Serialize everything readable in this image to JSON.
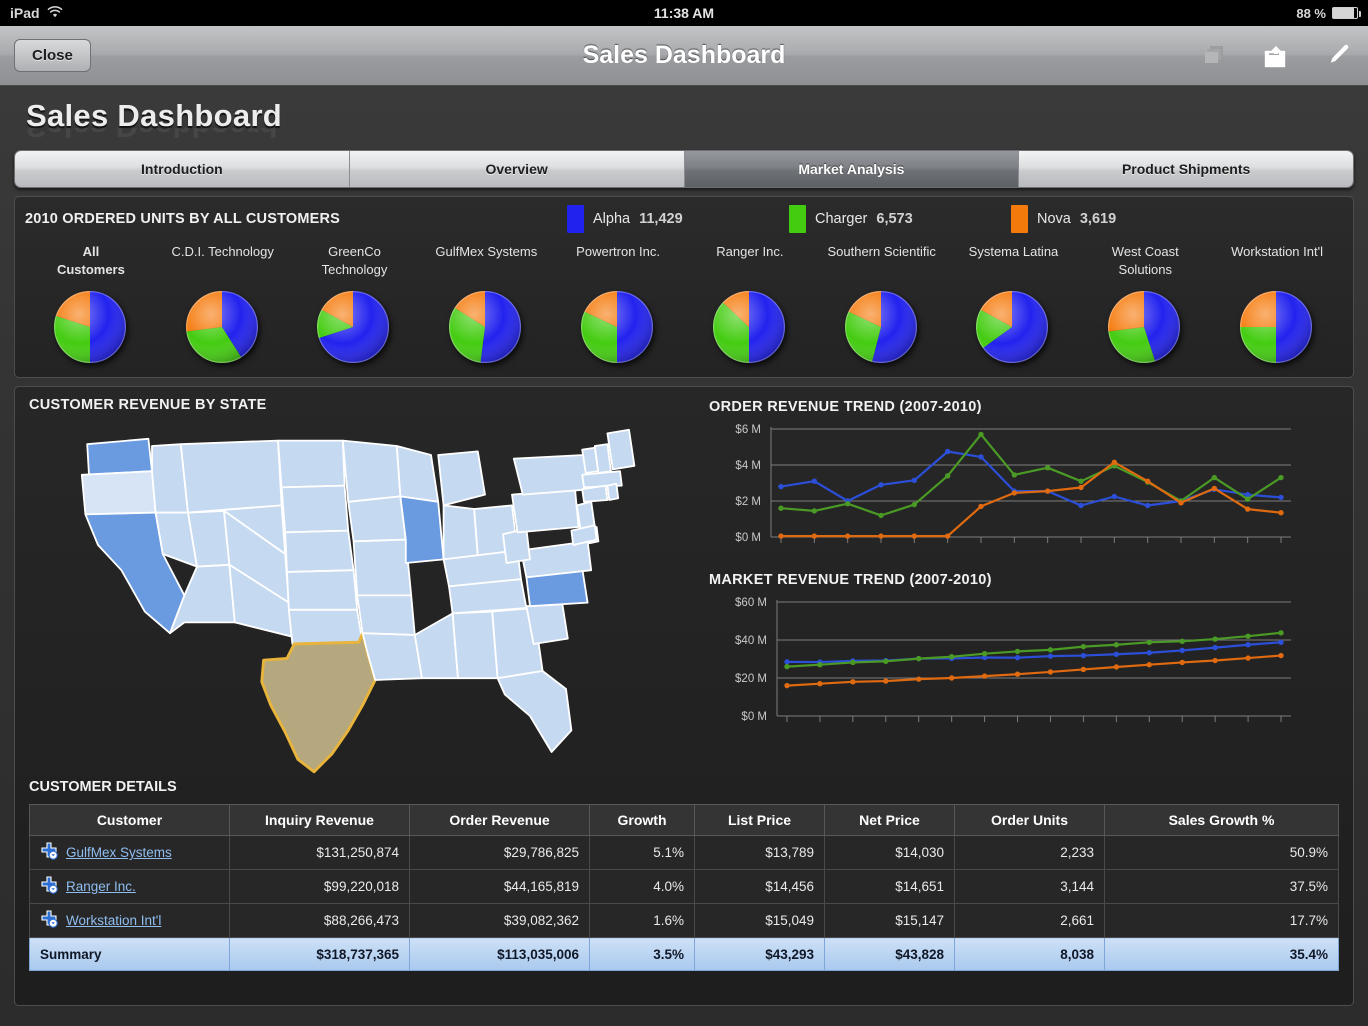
{
  "status_bar": {
    "device": "iPad",
    "wifi_icon": "wifi-icon",
    "time": "11:38 AM",
    "battery_percent": "88 %",
    "battery_level": 88
  },
  "toolbar": {
    "close_label": "Close",
    "title": "Sales Dashboard",
    "icons": [
      "layers-icon",
      "share-icon",
      "pencil-icon"
    ]
  },
  "header": {
    "dashboard_title": "Sales Dashboard"
  },
  "tabs": [
    {
      "label": "Introduction",
      "active": false
    },
    {
      "label": "Overview",
      "active": false
    },
    {
      "label": "Market Analysis",
      "active": true
    },
    {
      "label": "Product Shipments",
      "active": false
    }
  ],
  "pie_section": {
    "title": "2010 ORDERED UNITS BY ALL CUSTOMERS",
    "legend": [
      {
        "name": "Alpha",
        "value": "11,429",
        "color": "#2222ee"
      },
      {
        "name": "Charger",
        "value": "6,573",
        "color": "#44cc11"
      },
      {
        "name": "Nova",
        "value": "3,619",
        "color": "#f57a0c"
      }
    ]
  },
  "map_section": {
    "title": "CUSTOMER REVENUE BY STATE"
  },
  "table_section": {
    "title": "CUSTOMER DETAILS",
    "columns": [
      "Customer",
      "Inquiry Revenue",
      "Order Revenue",
      "Growth",
      "List Price",
      "Net Price",
      "Order Units",
      "Sales Growth %"
    ],
    "rows": [
      {
        "customer": "GulfMex Systems",
        "inquiry_revenue": "$131,250,874",
        "order_revenue": "$29,786,825",
        "growth": "5.1%",
        "list_price": "$13,789",
        "net_price": "$14,030",
        "order_units": "2,233",
        "sales_growth": "50.9%"
      },
      {
        "customer": "Ranger Inc.",
        "inquiry_revenue": "$99,220,018",
        "order_revenue": "$44,165,819",
        "growth": "4.0%",
        "list_price": "$14,456",
        "net_price": "$14,651",
        "order_units": "3,144",
        "sales_growth": "37.5%"
      },
      {
        "customer": "Workstation Int'l",
        "inquiry_revenue": "$88,266,473",
        "order_revenue": "$39,082,362",
        "growth": "1.6%",
        "list_price": "$15,049",
        "net_price": "$15,147",
        "order_units": "2,661",
        "sales_growth": "17.7%"
      }
    ],
    "summary": {
      "customer": "Summary",
      "inquiry_revenue": "$318,737,365",
      "order_revenue": "$113,035,006",
      "growth": "3.5%",
      "list_price": "$43,293",
      "net_price": "$43,828",
      "order_units": "8,038",
      "sales_growth": "35.4%"
    }
  },
  "chart_data": [
    {
      "type": "pie",
      "title": "2010 ORDERED UNITS BY ALL CUSTOMERS",
      "series_names": [
        "Alpha",
        "Charger",
        "Nova"
      ],
      "colors": [
        "#2222ee",
        "#44cc11",
        "#f57a0c"
      ],
      "totals": {
        "Alpha": 11429,
        "Charger": 6573,
        "Nova": 3619
      },
      "pies": [
        {
          "label": "All Customers",
          "label_lines": [
            "All",
            "Customers"
          ],
          "bold": true,
          "values": [
            50,
            30,
            20
          ]
        },
        {
          "label": "C.D.I. Technology",
          "label_lines": [
            "C.D.I. Technology"
          ],
          "bold": false,
          "values": [
            41,
            32,
            27
          ]
        },
        {
          "label": "GreenCo Technology",
          "label_lines": [
            "GreenCo",
            "Technology"
          ],
          "bold": false,
          "values": [
            70,
            13,
            17
          ]
        },
        {
          "label": "GulfMex Systems",
          "label_lines": [
            "GulfMex Systems"
          ],
          "bold": false,
          "values": [
            52,
            32,
            16
          ]
        },
        {
          "label": "Powertron Inc.",
          "label_lines": [
            "Powertron Inc."
          ],
          "bold": false,
          "values": [
            50,
            32,
            18
          ]
        },
        {
          "label": "Ranger Inc.",
          "label_lines": [
            "Ranger Inc."
          ],
          "bold": false,
          "values": [
            50,
            37,
            13
          ]
        },
        {
          "label": "Southern Scientific",
          "label_lines": [
            "Southern Scientific"
          ],
          "bold": false,
          "values": [
            54,
            28,
            18
          ]
        },
        {
          "label": "Systema Latina",
          "label_lines": [
            "Systema Latina"
          ],
          "bold": false,
          "values": [
            65,
            18,
            17
          ]
        },
        {
          "label": "West Coast Solutions",
          "label_lines": [
            "West Coast",
            "Solutions"
          ],
          "bold": false,
          "values": [
            45,
            28,
            27
          ]
        },
        {
          "label": "Workstation Int'l",
          "label_lines": [
            "Workstation Int'l"
          ],
          "bold": false,
          "values": [
            50,
            25,
            25
          ]
        }
      ]
    },
    {
      "type": "line",
      "title": "ORDER REVENUE TREND (2007-2010)",
      "ylabel": "",
      "xlabel": "",
      "ytick_labels": [
        "$0 M",
        "$2 M",
        "$4 M",
        "$6 M"
      ],
      "ylim": [
        0,
        6
      ],
      "grid": true,
      "legend": "none",
      "x": [
        1,
        2,
        3,
        4,
        5,
        6,
        7,
        8,
        9,
        10,
        11,
        12,
        13,
        14,
        15,
        16
      ],
      "series": [
        {
          "name": "Alpha",
          "color": "#2b4fd8",
          "values": [
            2.8,
            3.1,
            2.0,
            2.9,
            3.15,
            4.75,
            4.45,
            2.55,
            2.55,
            1.75,
            2.25,
            1.75,
            2.0,
            2.65,
            2.35,
            2.2
          ]
        },
        {
          "name": "Charger",
          "color": "#4a9a25",
          "values": [
            1.6,
            1.45,
            1.85,
            1.2,
            1.8,
            3.4,
            5.7,
            3.45,
            3.85,
            3.1,
            3.95,
            3.05,
            2.0,
            3.3,
            2.1,
            3.3
          ]
        },
        {
          "name": "Nova",
          "color": "#e06a10",
          "values": [
            0.05,
            0.05,
            0.05,
            0.05,
            0.05,
            0.05,
            1.7,
            2.45,
            2.55,
            2.75,
            4.15,
            3.1,
            1.9,
            2.7,
            1.55,
            1.35
          ]
        }
      ]
    },
    {
      "type": "line",
      "title": "MARKET REVENUE TREND (2007-2010)",
      "ylabel": "",
      "xlabel": "",
      "ytick_labels": [
        "$0 M",
        "$20 M",
        "$40 M",
        "$60 M"
      ],
      "ylim": [
        0,
        60
      ],
      "grid": true,
      "legend": "none",
      "x": [
        1,
        2,
        3,
        4,
        5,
        6,
        7,
        8,
        9,
        10,
        11,
        12,
        13,
        14,
        15,
        16
      ],
      "series": [
        {
          "name": "Alpha",
          "color": "#2b4fd8",
          "values": [
            28.5,
            28.4,
            29.0,
            29.2,
            30.2,
            30.3,
            30.8,
            30.7,
            31.5,
            31.8,
            32.5,
            33.3,
            34.5,
            36.0,
            37.5,
            38.8
          ]
        },
        {
          "name": "Charger",
          "color": "#4a9a25",
          "values": [
            26.0,
            27.0,
            28.2,
            28.8,
            30.2,
            31.2,
            32.8,
            34.0,
            34.8,
            36.5,
            37.5,
            38.8,
            39.3,
            40.5,
            42.0,
            43.8
          ]
        },
        {
          "name": "Nova",
          "color": "#e06a10",
          "values": [
            16.0,
            17.0,
            18.0,
            18.4,
            19.4,
            20.0,
            21.0,
            22.0,
            23.2,
            24.5,
            25.8,
            27.0,
            28.2,
            29.2,
            30.5,
            31.8
          ]
        }
      ]
    }
  ],
  "map_data": {
    "type": "choropleth",
    "title": "CUSTOMER REVENUE BY STATE",
    "selected_state": "Texas",
    "selected_fill": "#b5a77e",
    "selected_stroke": "#e8b43c",
    "highlight_states": [
      "Washington",
      "California",
      "Illinois",
      "North Carolina"
    ],
    "highlight_fill": "#6a9ae0",
    "base_fill": "#c5d9f1",
    "base_fill_light": "#d6e4f5"
  }
}
